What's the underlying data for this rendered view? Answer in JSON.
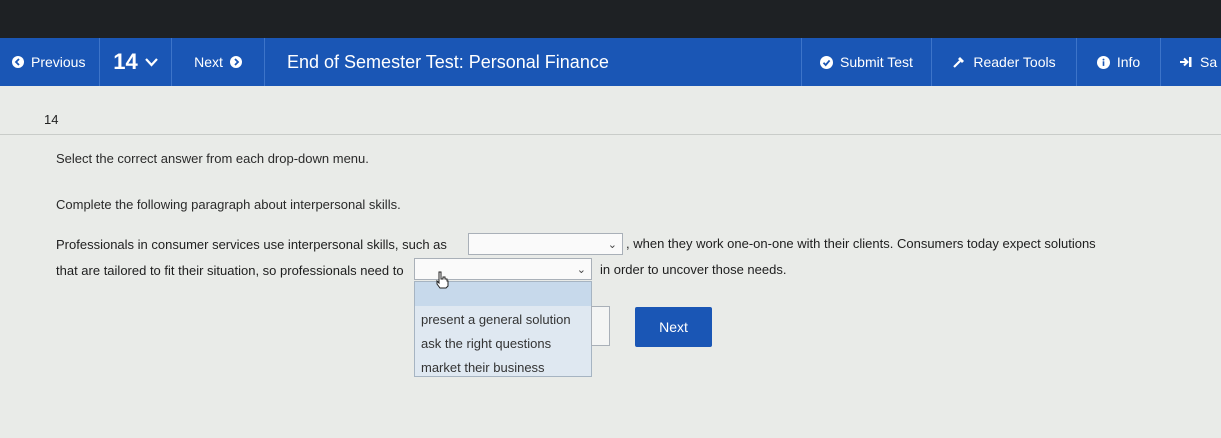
{
  "navbar": {
    "previous_label": "Previous",
    "question_number": "14",
    "next_label": "Next",
    "title": "End of Semester Test: Personal Finance",
    "submit_label": "Submit Test",
    "reader_tools_label": "Reader Tools",
    "info_label": "Info",
    "save_label_partial": "Sa"
  },
  "question": {
    "number": "14",
    "instruction": "Select the correct answer from each drop-down menu.",
    "sub_instruction": "Complete the following paragraph about interpersonal skills.",
    "line1_before": "Professionals in consumer services use interpersonal skills, such as",
    "line1_after": ", when they work one-on-one with their clients. Consumers today expect solutions",
    "line2_before": "that are tailored to fit their situation, so professionals need to",
    "line2_after": "in order to uncover those needs.",
    "dropdown1_value": "",
    "dropdown2_value": ""
  },
  "dropdown_menu": {
    "options": [
      "present a general solution",
      "ask the right questions",
      "market their business"
    ]
  },
  "footer": {
    "next_button": "Next"
  }
}
